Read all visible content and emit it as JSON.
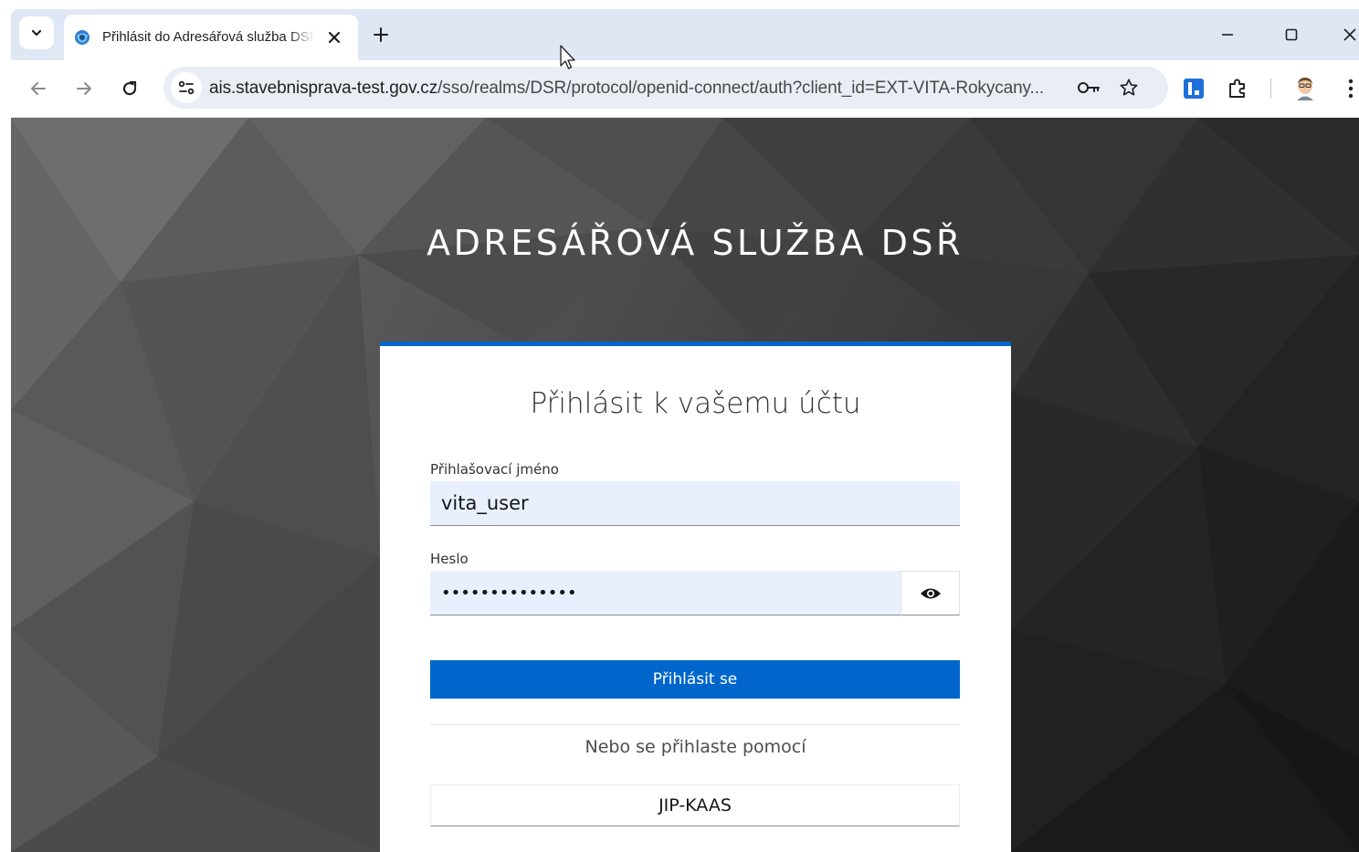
{
  "browser": {
    "tab": {
      "title": "Přihlásit do Adresářová služba DSŘ"
    },
    "address_bar": {
      "host": "ais.stavebnisprava-test.gov.cz",
      "path": "/sso/realms/DSR/protocol/openid-connect/auth?client_id=EXT-VITA-Rokycany..."
    }
  },
  "page": {
    "realm_title": "ADRESÁŘOVÁ SLUŽBA DSŘ",
    "card_title": "Přihlásit k vašemu účtu",
    "username": {
      "label": "Přihlašovací jméno",
      "value": "vita_user"
    },
    "password": {
      "label": "Heslo",
      "value": "••••••••••••••"
    },
    "submit_label": "Přihlásit se",
    "alt_login_text": "Nebo se přihlaste pomocí",
    "providers": [
      "JIP-KAAS"
    ]
  },
  "colors": {
    "accent": "#0066cc",
    "input_background": "#e8f0fe",
    "tabstrip": "#dfe7f5"
  },
  "icons": {
    "tab_search": "chevron-down-icon",
    "favicon": "site-favicon-icon",
    "tab_close": "close-icon",
    "new_tab": "plus-icon",
    "minimize": "minimize-icon",
    "maximize": "maximize-icon",
    "close_window": "close-icon",
    "back": "back-arrow-icon",
    "forward": "forward-arrow-icon",
    "reload": "reload-icon",
    "site_info": "site-info-icon",
    "password_manager": "key-icon",
    "bookmark": "star-icon",
    "extension": "extension-icon",
    "extensions_menu": "puzzle-icon",
    "profile": "avatar",
    "menu": "more-vert-icon",
    "show_password": "eye-icon"
  }
}
